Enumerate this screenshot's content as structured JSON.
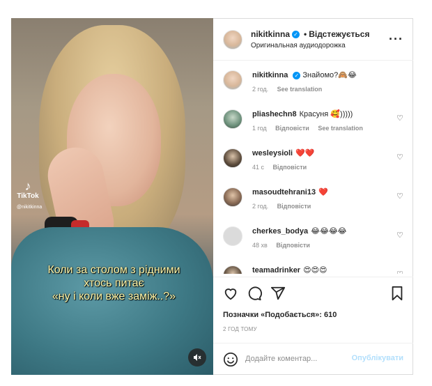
{
  "media": {
    "tiktok_logo_text": "TikTok",
    "tiktok_handle": "@nikitkinna",
    "caption_lines": [
      "Коли за столом з рідними",
      "хтось питає",
      "«ну і коли вже заміж..?»"
    ],
    "mute_icon": "speaker-muted-icon"
  },
  "header": {
    "username": "nikitkinna",
    "follow_status": "Відстежується",
    "audio_label": "Оригинальная аудиодорожка",
    "more_icon": "more-dots-icon"
  },
  "comments": [
    {
      "user": "nikitkinna",
      "text": "Знайомо?",
      "emoji": "🙈😂",
      "time": "2 год.",
      "reply": "",
      "translate": "See translation",
      "verified": true,
      "heart": false
    },
    {
      "user": "pliashechn8",
      "text": "Красуня",
      "emoji": "🥰",
      "tail": ")))))",
      "time": "1 год",
      "reply": "Відповісти",
      "translate": "See translation",
      "verified": false,
      "heart": true
    },
    {
      "user": "wesleysioli",
      "text": "",
      "emoji": "❤️❤️",
      "time": "41 с",
      "reply": "Відповісти",
      "translate": "",
      "verified": false,
      "heart": true
    },
    {
      "user": "masoudtehrani13",
      "text": "",
      "emoji": "❤️",
      "time": "2 год.",
      "reply": "Відповісти",
      "translate": "",
      "verified": false,
      "heart": true
    },
    {
      "user": "cherkes_bodya",
      "text": "",
      "emoji": "😂😂😂😂",
      "time": "48 хв",
      "reply": "Відповісти",
      "translate": "",
      "verified": false,
      "heart": true
    },
    {
      "user": "teamadrinker",
      "text": "",
      "emoji": "😍😍😍",
      "time": "",
      "reply": "",
      "translate": "",
      "verified": false,
      "heart": true
    }
  ],
  "actions": {
    "like_icon": "heart-icon",
    "comment_icon": "comment-bubble-icon",
    "share_icon": "paper-plane-icon",
    "save_icon": "bookmark-icon"
  },
  "likes_text": "Позначки «Подобається»: 610",
  "timestamp": "2 ГОД ТОМУ",
  "add_comment": {
    "placeholder": "Додайте коментар...",
    "publish_label": "Опублікувати",
    "emoji_icon": "smiley-icon"
  },
  "colors": {
    "accent": "#0095f6",
    "publish_disabled": "#b2dffc",
    "heart_red": "#ed4956",
    "caption_yellow": "#fff6a8"
  }
}
